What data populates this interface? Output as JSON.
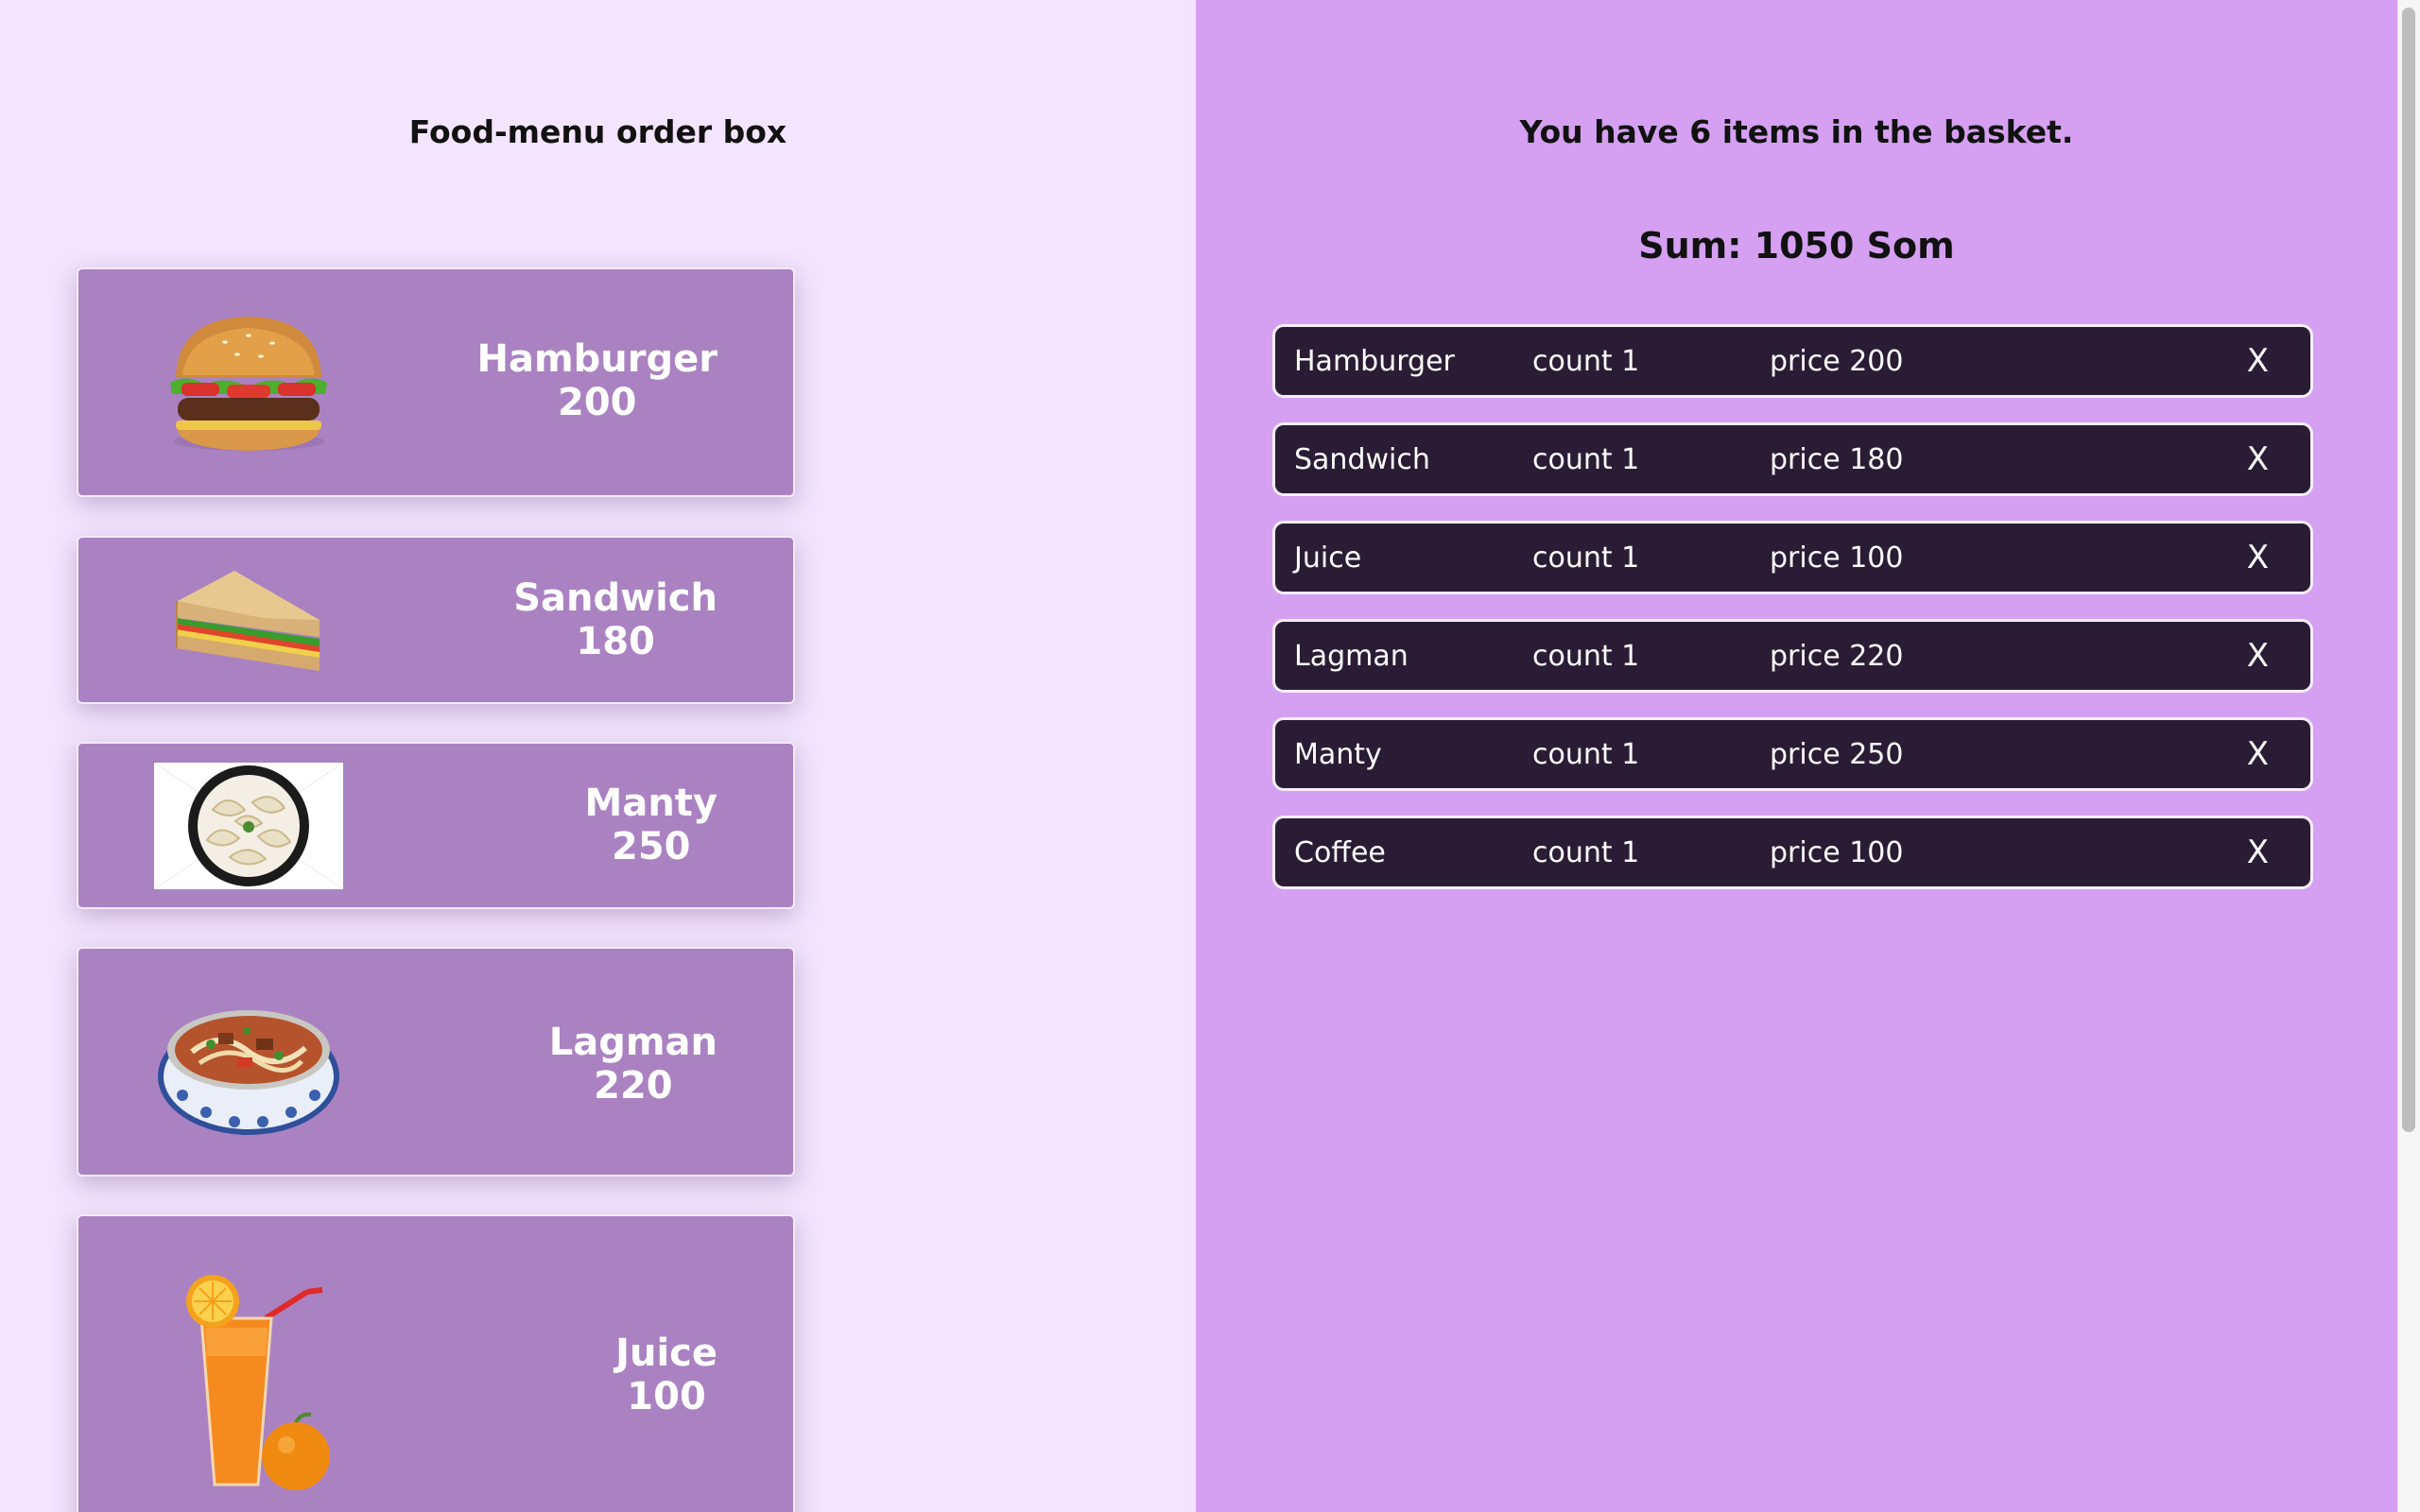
{
  "menu": {
    "title": "Food-menu order box",
    "items": [
      {
        "name": "Hamburger",
        "price": "200",
        "image": "hamburger"
      },
      {
        "name": "Sandwich",
        "price": "180",
        "image": "sandwich"
      },
      {
        "name": "Manty",
        "price": "250",
        "image": "manty"
      },
      {
        "name": "Lagman",
        "price": "220",
        "image": "lagman"
      },
      {
        "name": "Juice",
        "price": "100",
        "image": "juice"
      }
    ]
  },
  "basket": {
    "title": "You have 6 items in the basket.",
    "sum": "Sum: 1050 Som",
    "remove_label": "X",
    "rows": [
      {
        "name": "Hamburger",
        "count": "count 1",
        "price": "price 200"
      },
      {
        "name": "Sandwich",
        "count": "count 1",
        "price": "price 180"
      },
      {
        "name": "Juice",
        "count": "count 1",
        "price": "price 100"
      },
      {
        "name": "Lagman",
        "count": "count 1",
        "price": "price 220"
      },
      {
        "name": "Manty",
        "count": "count 1",
        "price": "price 250"
      },
      {
        "name": "Coffee",
        "count": "count 1",
        "price": "price 100"
      }
    ]
  },
  "colors": {
    "left_background": "#f3e5fd",
    "right_background": "#d5a0f1",
    "card_background": "#aa82c2",
    "row_background": "#2b1c35"
  }
}
